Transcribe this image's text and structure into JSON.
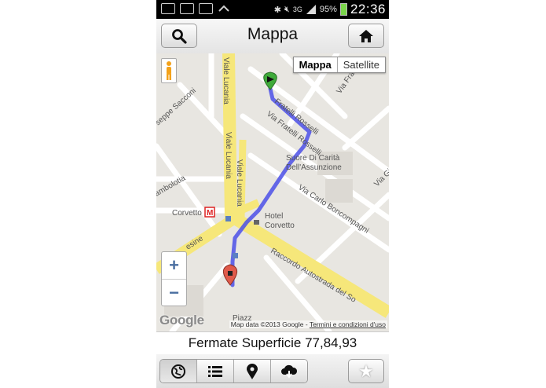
{
  "status_bar": {
    "network": "3G",
    "battery_percent": "95%",
    "time": "22:36"
  },
  "title_bar": {
    "title": "Mappa",
    "search_icon": "search-icon",
    "home_icon": "home-icon"
  },
  "map": {
    "map_type_options": [
      "Mappa",
      "Satellite"
    ],
    "selected_map_type": "Mappa",
    "zoom_in": "+",
    "zoom_out": "−",
    "logo": "Google",
    "attribution": "Map data ©2013 Google -",
    "terms_link": "Termini e condizioni d'uso",
    "street_labels": {
      "viale_lucania_top": "Viale Lucania",
      "viale_lucania_mid": "Viale Lucania",
      "viale_lucania_low": "Viale Lucania",
      "fratelli_rosselli_1": "Fratelli Rosselli",
      "fratelli_rosselli_2": "Via Fratelli Rosselli",
      "via_fra": "Via Fran",
      "sacconi": "seppe Sacconi",
      "suore": "Suore Di Carità",
      "assunzione": "Dell'Assunzione",
      "boncompagni": "Via Carlo Boncompagni",
      "via_gi": "Via Gi",
      "sambolotia": "ambolotia",
      "corvetto": "Corvetto",
      "metro": "M",
      "hotel": "Hotel",
      "hotel_name": "Corvetto",
      "raccordo": "Raccordo Autostrada del So",
      "esine": "esine",
      "piazza": "Piazz"
    },
    "route_color": "#4b4fe8",
    "start_marker_color": "#3faa3a",
    "end_marker_color": "#e05a4a"
  },
  "info_bar": {
    "text": "Fermate Superficie 77,84,93"
  },
  "bottom_bar": {
    "tabs": [
      {
        "name": "globe-icon",
        "selected": true
      },
      {
        "name": "list-icon",
        "selected": false
      },
      {
        "name": "location-pin-icon",
        "selected": false
      },
      {
        "name": "cloud-download-icon",
        "selected": false
      }
    ],
    "favorite_icon": "star-icon"
  }
}
